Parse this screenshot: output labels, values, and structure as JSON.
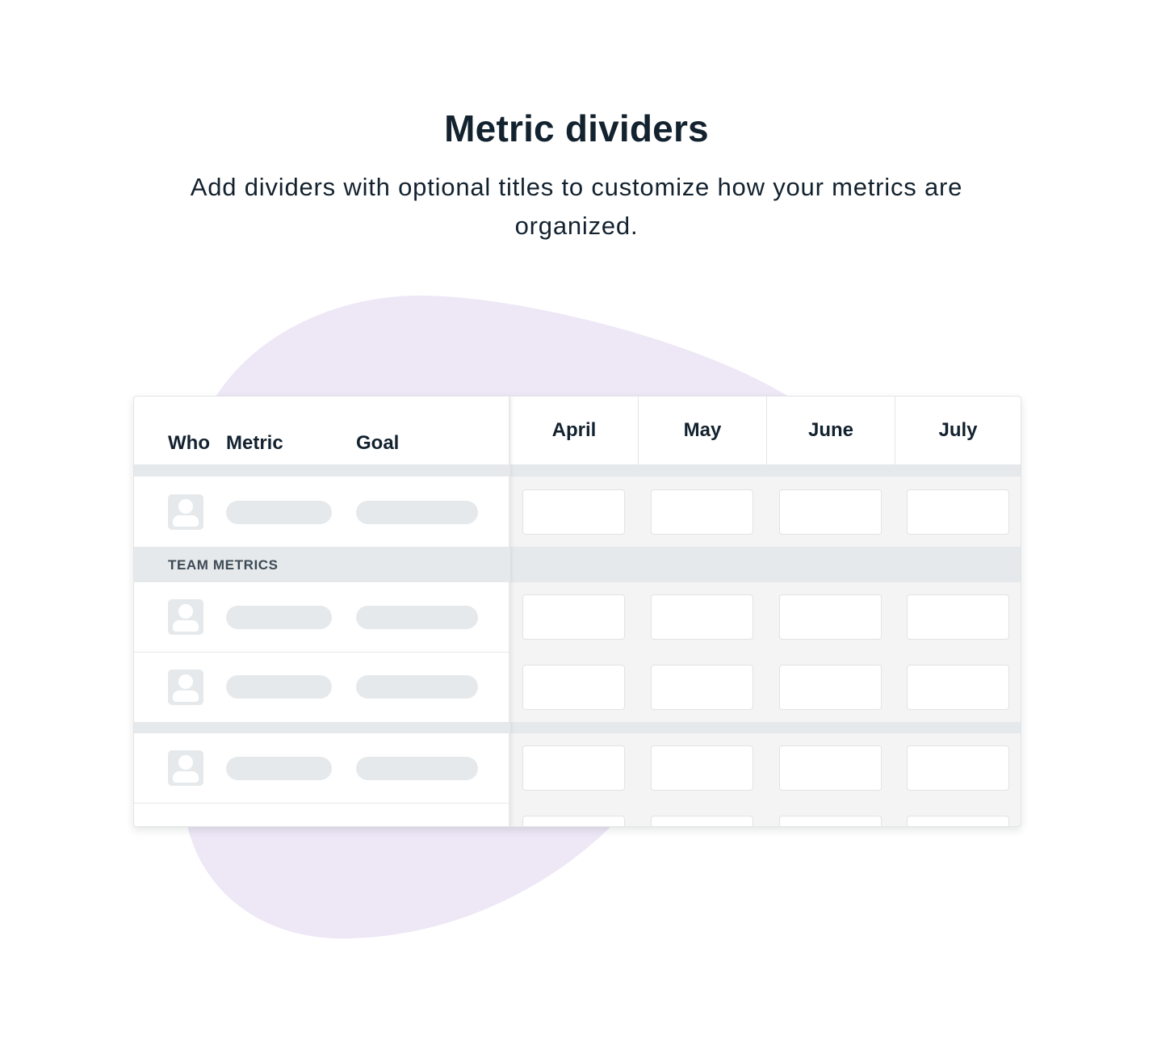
{
  "page": {
    "title": "Metric dividers",
    "subtitle": "Add dividers with optional titles to customize how your metrics are organized."
  },
  "table": {
    "columns": {
      "who": "Who",
      "metric": "Metric",
      "goal": "Goal"
    },
    "months": [
      "April",
      "May",
      "June",
      "July"
    ],
    "divider_title": "TEAM METRICS"
  },
  "colors": {
    "blob": "#ede7f6",
    "text": "#13222f",
    "placeholder": "#e6e9eb",
    "grid_background": "#f4f4f4"
  },
  "icons": {
    "avatar": "person-placeholder-icon"
  }
}
